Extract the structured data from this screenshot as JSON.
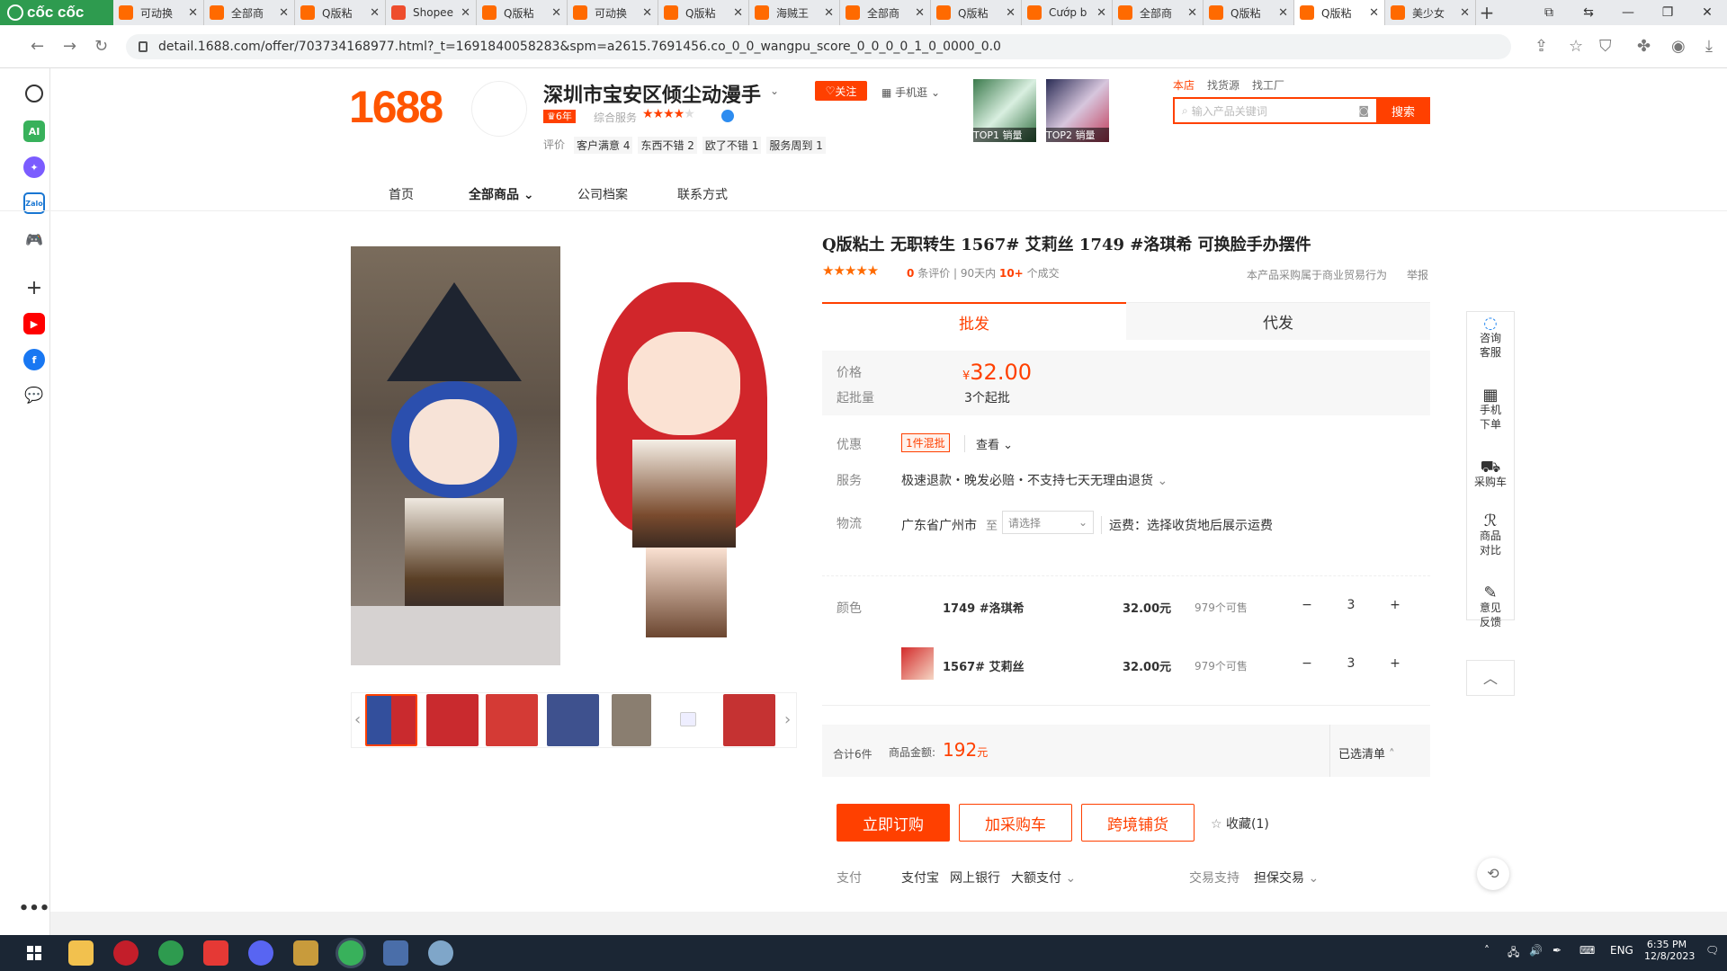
{
  "browser": {
    "brand": "cốc cốc",
    "tabs": [
      {
        "label": "可动换"
      },
      {
        "label": "全部商"
      },
      {
        "label": "Q版粘"
      },
      {
        "label": "Shopee"
      },
      {
        "label": "Q版粘"
      },
      {
        "label": "可动换"
      },
      {
        "label": "Q版粘"
      },
      {
        "label": "海贼王"
      },
      {
        "label": "全部商"
      },
      {
        "label": "Q版粘"
      },
      {
        "label": "Cướp b"
      },
      {
        "label": "全部商"
      },
      {
        "label": "Q版粘"
      },
      {
        "label": "Q版粘"
      },
      {
        "label": "美少女"
      }
    ],
    "url": "detail.1688.com/offer/703734168977.html?_t=1691840058283&spm=a2615.7691456.co_0_0_wangpu_score_0_0_0_0_1_0_0000_0.0"
  },
  "shop": {
    "logo": "1688",
    "name": "深圳市宝安区倾尘动漫手",
    "follow": "关注",
    "phone_shop": "手机逛",
    "years_badge": "6年",
    "service_label": "综合服务",
    "rating_label": "评价",
    "ratings": [
      "客户满意 4",
      "东西不错 2",
      "欧了不错 1",
      "服务周到 1"
    ],
    "top1": "TOP1 销量",
    "top2": "TOP2 销量",
    "search_scopes": [
      "本店",
      "找货源",
      "找工厂"
    ],
    "search_placeholder": "输入产品关键词",
    "search_button": "搜索"
  },
  "nav": [
    "首页",
    "全部商品",
    "公司档案",
    "联系方式"
  ],
  "product": {
    "title": "Q版粘土 无职转生 1567# 艾莉丝 1749 #洛琪希 可换脸手办摆件",
    "reviews": "0",
    "reviews_suffix": "条评价",
    "sold_prefix": "90天内",
    "sold_count": "10+",
    "sold_suffix": "个成交",
    "notice": "本产品采购属于商业贸易行为",
    "report": "举报",
    "tabs": [
      "批发",
      "代发"
    ],
    "price_label": "价格",
    "currency": "¥",
    "price": "32.00",
    "moq_label": "起批量",
    "moq": "3个起批",
    "promo_label": "优惠",
    "promo_badge": "1件混批",
    "promo_view": "查看",
    "service_label": "服务",
    "service": "极速退款・晚发必赔・不支持七天无理由退货",
    "logistics_label": "物流",
    "origin": "广东省广州市",
    "to": "至",
    "dest_placeholder": "请选择",
    "freight": "运费：选择收货地后展示运费",
    "color_label": "颜色",
    "variants": [
      {
        "name": "1749 #洛琪希",
        "price": "32.00元",
        "stock": "979个可售",
        "qty": "3"
      },
      {
        "name": "1567# 艾莉丝",
        "price": "32.00元",
        "stock": "979个可售",
        "qty": "3"
      }
    ],
    "total_count": "合计6件",
    "amount_label": "商品金额:",
    "amount": "192",
    "amount_unit": "元",
    "selected_list": "已选清单",
    "buy_now": "立即订购",
    "add_cart": "加采购车",
    "cross_border": "跨境铺货",
    "favorite": "收藏(1)",
    "pay_label": "支付",
    "pay_methods": [
      "支付宝",
      "网上银行",
      "大额支付"
    ],
    "trade_label": "交易支持",
    "trade": "担保交易"
  },
  "right_tools": [
    {
      "label": "咨询客服"
    },
    {
      "label": "手机下单"
    },
    {
      "label": "采购车"
    },
    {
      "label": "商品对比"
    },
    {
      "label": "意见反馈"
    }
  ],
  "taskbar": {
    "lang": "ENG",
    "time": "6:35 PM",
    "date": "12/8/2023"
  },
  "colors": {
    "accent": "#ff4000",
    "brand": "#ff5500",
    "browser_green": "#2e9b4f"
  }
}
